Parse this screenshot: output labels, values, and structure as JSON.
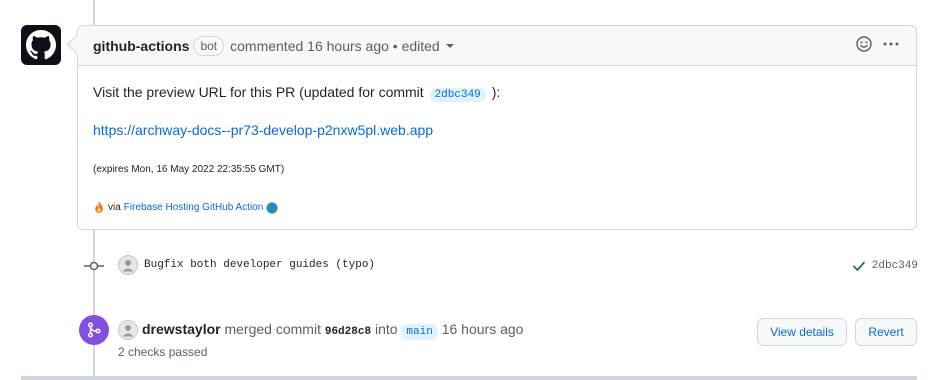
{
  "comment": {
    "author": "github-actions",
    "badge": "bot",
    "meta": "commented 16 hours ago • edited",
    "body": {
      "intro_text": "Visit the preview URL for this PR (updated for commit",
      "commit_sha": "2dbc349",
      "intro_suffix": "):",
      "preview_url": "https://archway-docs--pr73-develop-p2nxw5pl.web.app",
      "expires": "(expires Mon, 16 May 2022 22:35:55 GMT)",
      "via_prefix": "via",
      "via_link": "Firebase Hosting GitHub Action"
    }
  },
  "commit": {
    "message": "Bugfix both developer guides (typo)",
    "sha": "2dbc349"
  },
  "merge": {
    "user": "drewstaylor",
    "action": "merged commit",
    "sha": "96d28c8",
    "into": "into",
    "branch": "main",
    "time": "16 hours ago",
    "checks": "2 checks passed",
    "view_details_label": "View details",
    "revert_label": "Revert"
  },
  "colors": {
    "merge_purple": "#8250df",
    "link_blue": "#0969da",
    "success_green": "#1a7f37"
  }
}
